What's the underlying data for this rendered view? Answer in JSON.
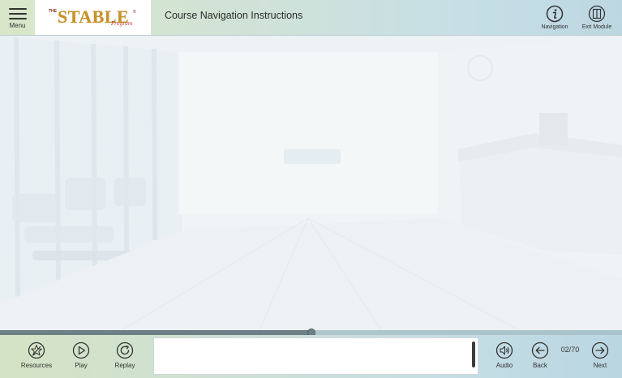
{
  "header": {
    "menu_label": "Menu",
    "logo": {
      "prefix": "THE",
      "name": "STABLE",
      "suffix": "Program",
      "mark": "®"
    },
    "title": "Course Navigation Instructions",
    "navigation_label": "Navigation",
    "exit_label": "Exit Module"
  },
  "progress": {
    "value": 0.5
  },
  "footer": {
    "resources_label": "Resources",
    "play_label": "Play",
    "replay_label": "Replay",
    "audio_label": "Audio",
    "back_label": "Back",
    "page_counter": "02/70",
    "next_label": "Next"
  },
  "caption": {
    "text": ""
  },
  "colors": {
    "logo_gold": "#c9932a",
    "logo_red": "#b8322a",
    "icon_stroke": "#333333"
  },
  "icons": [
    "hamburger-icon",
    "info-icon",
    "exit-icon",
    "resources-icon",
    "play-icon",
    "replay-icon",
    "audio-icon",
    "back-arrow-icon",
    "next-arrow-icon"
  ]
}
